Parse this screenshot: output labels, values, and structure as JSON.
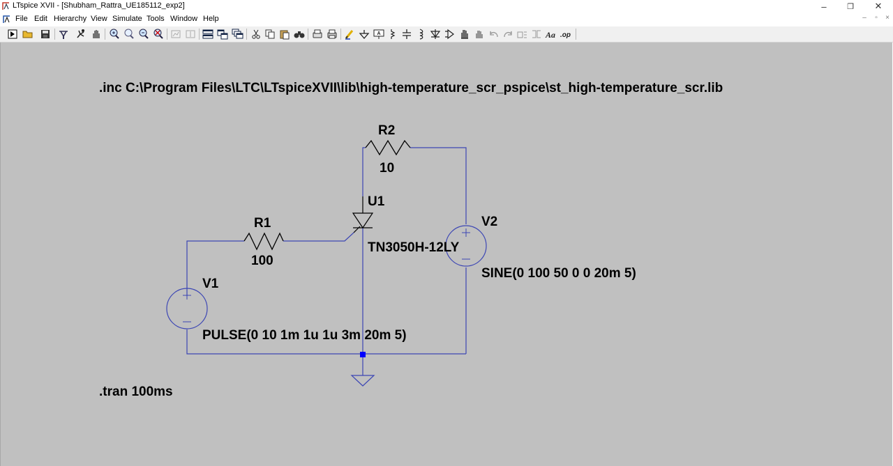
{
  "window": {
    "title": "LTspice XVII - [Shubham_Rattra_UE185112_exp2]",
    "controls": {
      "minimize": "–",
      "restore": "❐",
      "close": "✕"
    }
  },
  "menu": {
    "items": [
      "File",
      "Edit",
      "Hierarchy",
      "View",
      "Simulate",
      "Tools",
      "Window",
      "Help"
    ],
    "mdi_controls": {
      "minimize": "–",
      "restore": "▫",
      "close": "×"
    }
  },
  "toolbar": {
    "icons": [
      "run-icon",
      "open-icon",
      "save-icon",
      "control-panel-icon",
      "halt-icon",
      "pan-icon",
      "zoom-in-icon",
      "zoom-area-icon",
      "zoom-out-icon",
      "zoom-fit-icon",
      "autoscale-icon",
      "vertical-autorange-icon",
      "tile-horizontal-icon",
      "tile-vertical-icon",
      "cascade-icon",
      "cut-icon",
      "copy-icon",
      "paste-icon",
      "find-icon",
      "print-setup-icon",
      "print-icon",
      "wire-icon",
      "ground-icon",
      "label-net-icon",
      "resistor-icon",
      "capacitor-icon",
      "inductor-icon",
      "diode-icon",
      "component-icon",
      "move-icon",
      "drag-icon",
      "undo-icon",
      "redo-icon",
      "rotate-icon",
      "mirror-icon",
      "text-icon",
      "spice-directive-icon"
    ]
  },
  "schematic": {
    "include_directive": ".inc C:\\Program Files\\LTC\\LTspiceXVII\\lib\\high-temperature_scr_pspice\\st_high-temperature_scr.lib",
    "tran_directive": ".tran 100ms",
    "r1": {
      "name": "R1",
      "value": "100"
    },
    "r2": {
      "name": "R2",
      "value": "10"
    },
    "u1": {
      "name": "U1",
      "value": "TN3050H-12LY"
    },
    "v1": {
      "name": "V1",
      "value": "PULSE(0 10 1m 1u 1u 3m 20m 5)"
    },
    "v2": {
      "name": "V2",
      "value": "SINE(0 100 50 0 0 20m 5)"
    },
    "colors": {
      "wire": "#3c46b4",
      "background": "#c0c0c0",
      "junction": "#0000ff"
    }
  }
}
